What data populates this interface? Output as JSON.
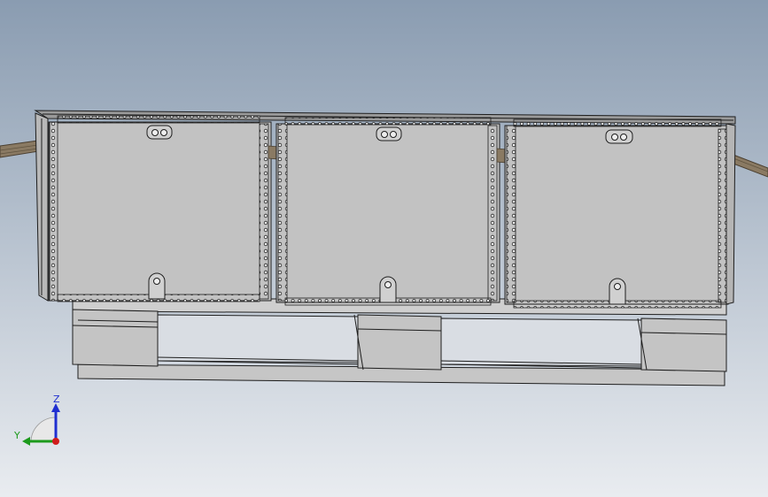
{
  "viewport": {
    "background_top": "#8a9cb1",
    "background_bottom": "#e9ecf0"
  },
  "model": {
    "panel_color": "#c2c2c2",
    "edge_color": "#1e1e1e",
    "pallet_color": "#c8c8c8",
    "strap_color": "#8a7a63",
    "crate_count": 3
  },
  "triad": {
    "z_label": "Z",
    "y_label": "Y",
    "z_color": "#1f2fd0",
    "y_color": "#1c9a1c",
    "x_color": "#d01c1c"
  }
}
